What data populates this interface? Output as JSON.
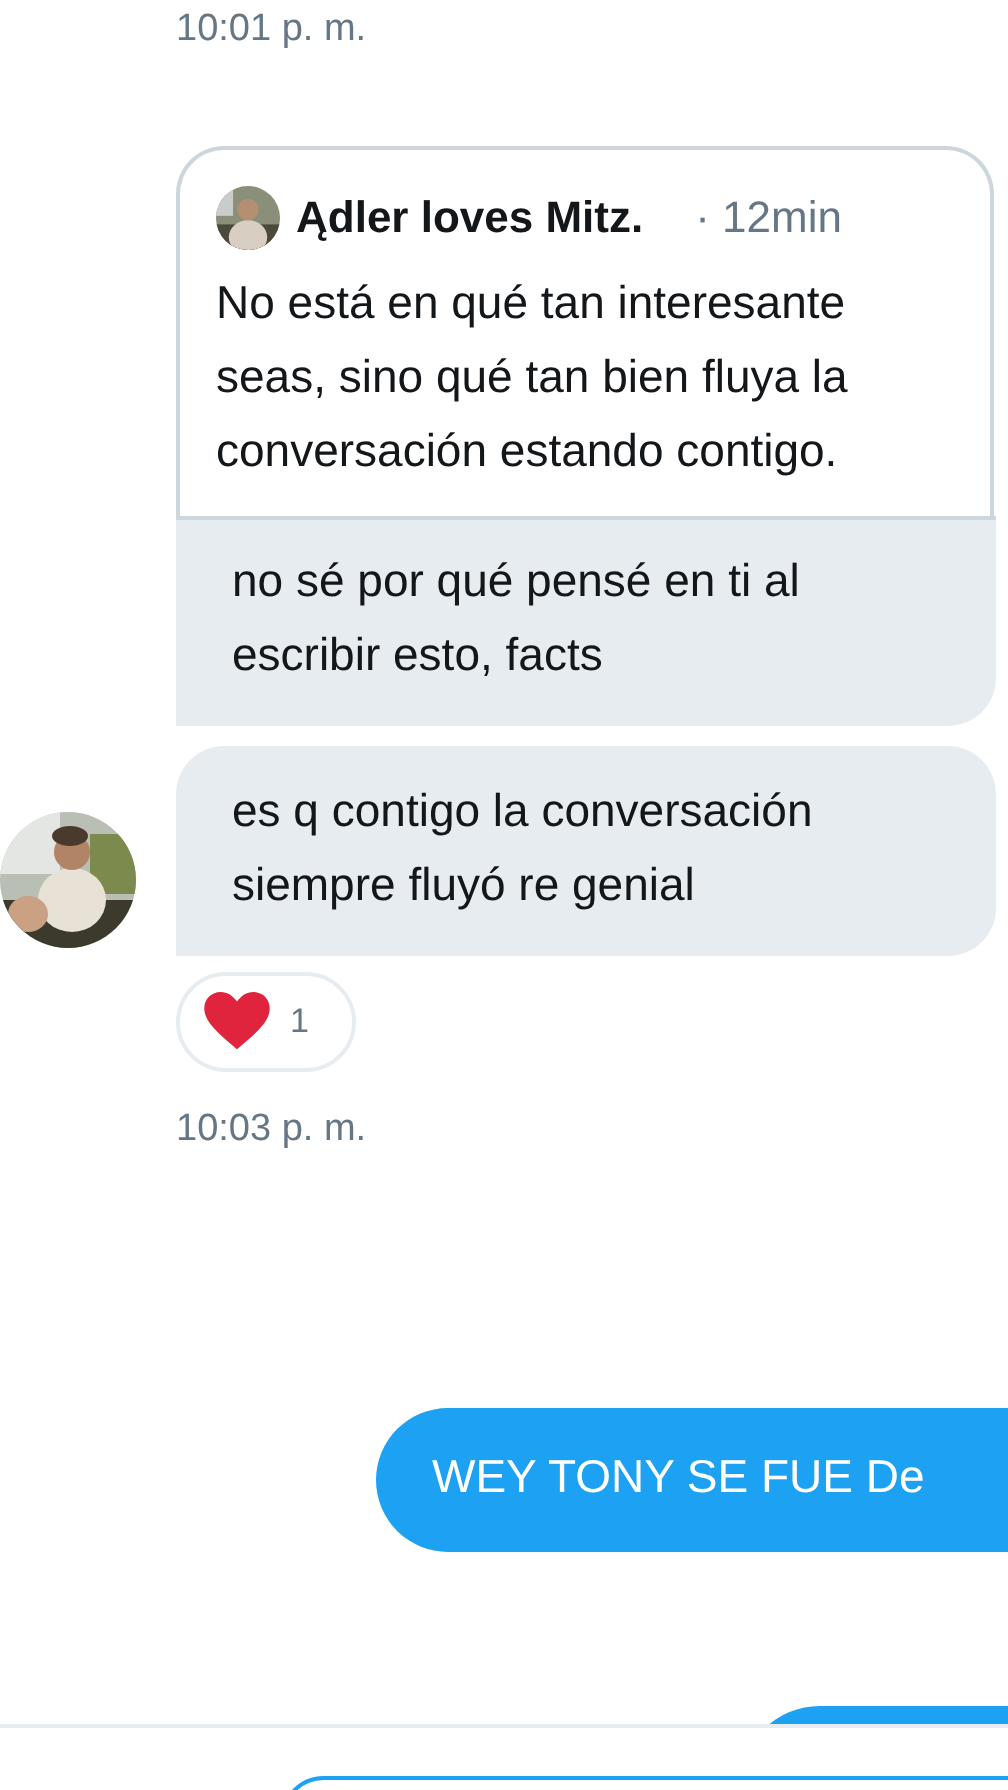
{
  "timestamp_top": "10:01 p. m.",
  "quoted_tweet": {
    "author": "Ądler loves Mitz.",
    "time": "· 12min",
    "text": "No está en qué tan interesante seas, sino qué tan bien fluya la conversación estando contigo."
  },
  "messages": [
    {
      "text": "no sé por qué pensé en ti al escribir esto, facts"
    },
    {
      "text": "es q contigo la conversación siempre fluyó re genial"
    }
  ],
  "reaction": {
    "count": "1"
  },
  "timestamp_bottom": "10:03 p. m.",
  "sent_message": {
    "text": "WEY TONY SE FUE De"
  }
}
